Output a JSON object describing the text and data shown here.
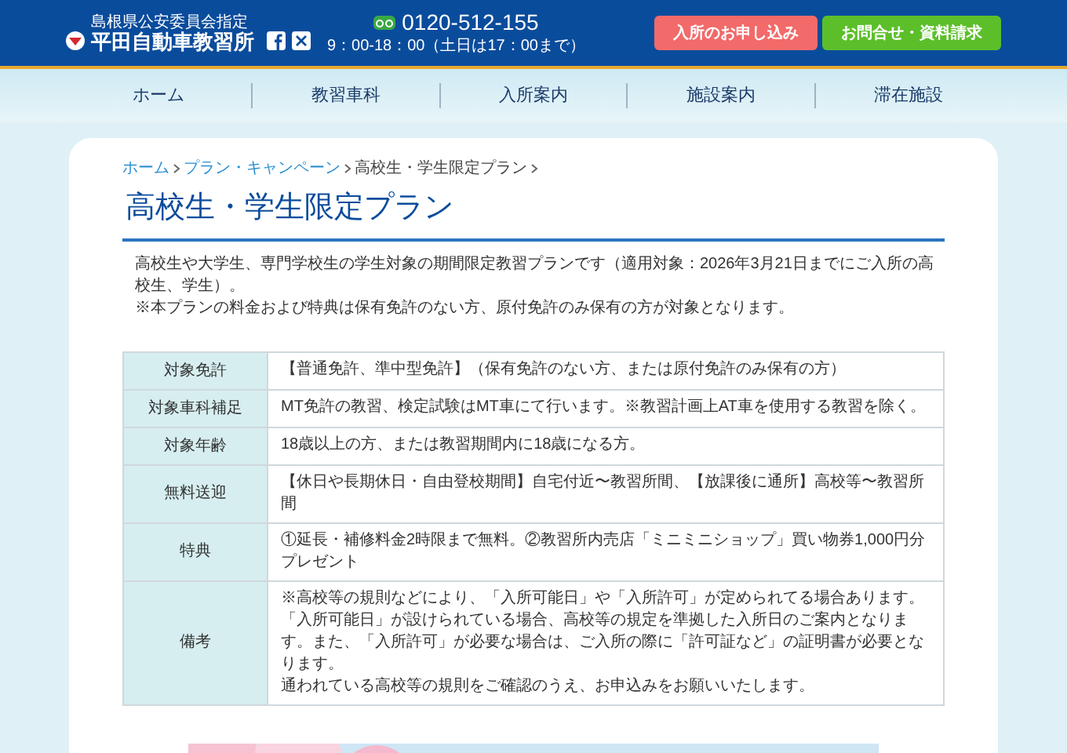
{
  "header": {
    "logo_caption": "島根県公安委員会指定",
    "logo_text": "平田自動車教習所",
    "phone": "0120-512-155",
    "hours": "9：00-18：00（土日は17：00まで）",
    "buttons": [
      {
        "label": "入所のお申し込み",
        "color": "#f26a6a"
      },
      {
        "label": "お問合せ・資料請求",
        "color": "#5cbf2a"
      }
    ]
  },
  "nav": {
    "items": [
      {
        "label": "ホーム"
      },
      {
        "label": "教習車科"
      },
      {
        "label": "入所案内"
      },
      {
        "label": "施設案内"
      },
      {
        "label": "滞在施設"
      }
    ]
  },
  "breadcrumb": [
    {
      "label": "ホーム",
      "kind": "link"
    },
    {
      "label": "プラン・キャンペーン",
      "kind": "link"
    },
    {
      "label": "高校生・学生限定プラン",
      "kind": "current"
    }
  ],
  "title": "高校生・学生限定プラン",
  "intro": [
    "高校生や大学生、専門学校生の学生対象の期間限定教習プランです（適用対象：2026年3月21日までにご入所の高校生、学生）。",
    "※本プランの料金および特典は保有免許のない方、原付免許のみ保有の方が対象となります。"
  ],
  "table": {
    "rows": [
      {
        "label": "対象免許",
        "lines": [
          "【普通免許、準中型免許】（保有免許のない方、または原付免許のみ保有の方）"
        ]
      },
      {
        "label": "対象車科補足",
        "lines": [
          "MT免許の教習、検定試験はMT車にて行います。※教習計画上AT車を使用する教習を除く。"
        ]
      },
      {
        "label": "対象年齢",
        "lines": [
          "18歳以上の方、または教習期間内に18歳になる方。"
        ]
      },
      {
        "label": "無料送迎",
        "lines": [
          "【休日や長期休日・自由登校期間】自宅付近〜教習所間、【放課後に通所】高校等〜教習所間"
        ]
      },
      {
        "label": "特典",
        "lines": [
          "①延長・補修料金2時限まで無料。②教習所内売店「ミニミニショップ」買い物券1,000円分プレゼント"
        ]
      },
      {
        "label": "備考",
        "lines": [
          "※高校等の規則などにより、「入所可能日」や「入所許可」が定められてる場合あります。「入所可能日」が設けられている場合、高校等の規定を準拠した入所日のご案内となります。また、「入所許可」が必要な場合は、ご入所の際に「許可証など」の証明書が必要となります。",
          "通われている高校等の規則をご確認のうえ、お申込みをお願いいたします。"
        ]
      }
    ]
  },
  "banner": {
    "kind": "picture"
  }
}
